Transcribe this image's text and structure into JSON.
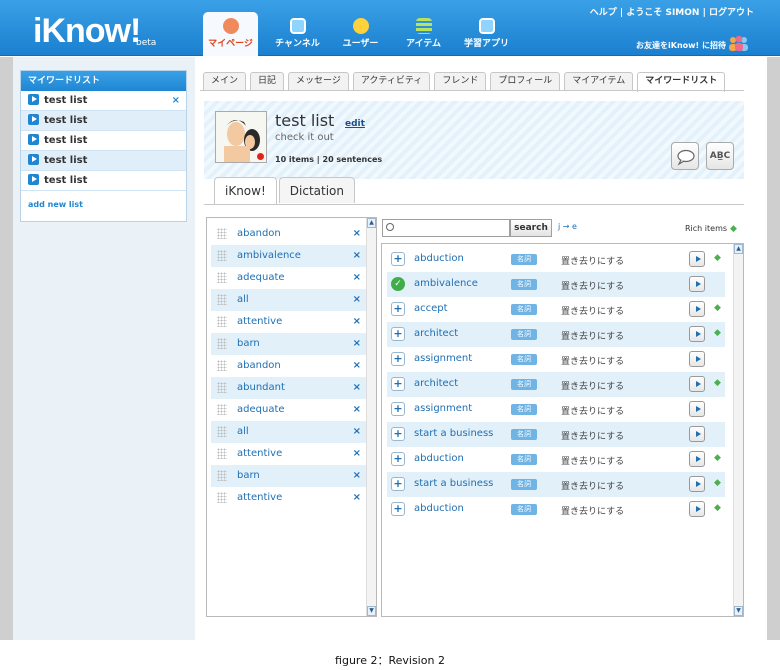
{
  "header": {
    "logo": "iKnow!",
    "logo_suffix": "beta",
    "top_links": "ヘルプ | ようこそ SIMON | ログアウト",
    "invite_text": "お友達をiKnow! に招待",
    "nav": [
      {
        "label": "マイページ",
        "icon": "mypage-icon",
        "color": "#f08a5d"
      },
      {
        "label": "チャンネル",
        "icon": "tv-icon",
        "color": "#8fd3ff"
      },
      {
        "label": "ユーザー",
        "icon": "users-icon",
        "color": "#ffd23c"
      },
      {
        "label": "アイテム",
        "icon": "list-icon",
        "color": "#b8e35a"
      },
      {
        "label": "学習アプリ",
        "icon": "app-icon",
        "color": "#8fd3ff"
      }
    ]
  },
  "sidebar": {
    "title": "マイワードリスト",
    "items": [
      {
        "label": "test list"
      },
      {
        "label": "test list"
      },
      {
        "label": "test list"
      },
      {
        "label": "test list"
      },
      {
        "label": "test list"
      }
    ],
    "remove_glyph": "×",
    "add_label": "add new list"
  },
  "tabs": [
    "メイン",
    "日記",
    "メッセージ",
    "アクティビティ",
    "フレンド",
    "プロフィール",
    "マイアイテム",
    "マイワードリスト"
  ],
  "profile": {
    "title": "test list",
    "edit": "edit",
    "description": "check it out",
    "stats": "10 items | 20 sentences",
    "abc_label": "AB̲C"
  },
  "mode_tabs": [
    "iKnow!",
    "Dictation"
  ],
  "word_list": {
    "words": [
      "abandon",
      "ambivalence",
      "adequate",
      "all",
      "attentive",
      "barn",
      "abandon",
      "abundant",
      "adequate",
      "all",
      "attentive",
      "barn",
      "attentive"
    ],
    "remove_glyph": "×"
  },
  "search": {
    "placeholder": "",
    "button": "search",
    "lang_toggle": "j → e",
    "rich_label": "Rich items"
  },
  "items": [
    {
      "word": "abduction",
      "pos": "名詞",
      "meaning": "置き去りにする",
      "status": "add",
      "rich": true
    },
    {
      "word": "ambivalence",
      "pos": "名詞",
      "meaning": "置き去りにする",
      "status": "done",
      "rich": false
    },
    {
      "word": "accept",
      "pos": "名詞",
      "meaning": "置き去りにする",
      "status": "add",
      "rich": true
    },
    {
      "word": "architect",
      "pos": "名詞",
      "meaning": "置き去りにする",
      "status": "add",
      "rich": true
    },
    {
      "word": "assignment",
      "pos": "名詞",
      "meaning": "置き去りにする",
      "status": "add",
      "rich": false
    },
    {
      "word": "architect",
      "pos": "名詞",
      "meaning": "置き去りにする",
      "status": "add",
      "rich": true
    },
    {
      "word": "assignment",
      "pos": "名詞",
      "meaning": "置き去りにする",
      "status": "add",
      "rich": false
    },
    {
      "word": "start a business",
      "pos": "名詞",
      "meaning": "置き去りにする",
      "status": "add",
      "rich": false
    },
    {
      "word": "abduction",
      "pos": "名詞",
      "meaning": "置き去りにする",
      "status": "add",
      "rich": true
    },
    {
      "word": "start a business",
      "pos": "名詞",
      "meaning": "置き去りにする",
      "status": "add",
      "rich": true
    },
    {
      "word": "abduction",
      "pos": "名詞",
      "meaning": "置き去りにする",
      "status": "add",
      "rich": true
    }
  ],
  "caption": "figure 2：Revision 2",
  "colors": {
    "accent": "#1f86d3",
    "rich": "#4caf50",
    "active_nav": "#e0421b"
  }
}
